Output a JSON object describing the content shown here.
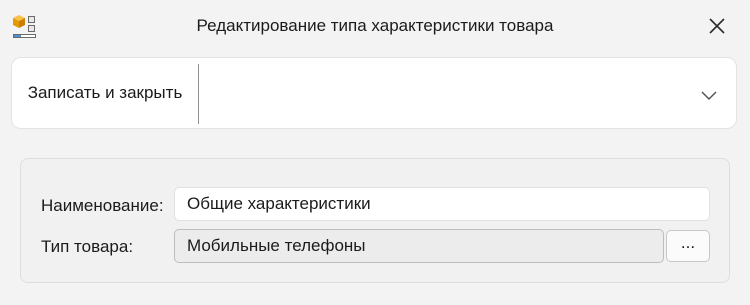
{
  "window": {
    "title": "Редактирование типа характеристики товара",
    "app_icon": "boxes-app-icon",
    "close_icon": "close-icon"
  },
  "toolbar": {
    "save_close_label": "Записать и закрыть",
    "more_icon": "chevron-down-icon"
  },
  "form": {
    "name_label": "Наименование:",
    "name_value": "Общие характеристики",
    "type_label": "Тип товара:",
    "type_value": "Мобильные телефоны",
    "select_button_label": "..."
  },
  "colors": {
    "accent_orange": "#f0a500",
    "window_bg": "#f3f3f3"
  }
}
